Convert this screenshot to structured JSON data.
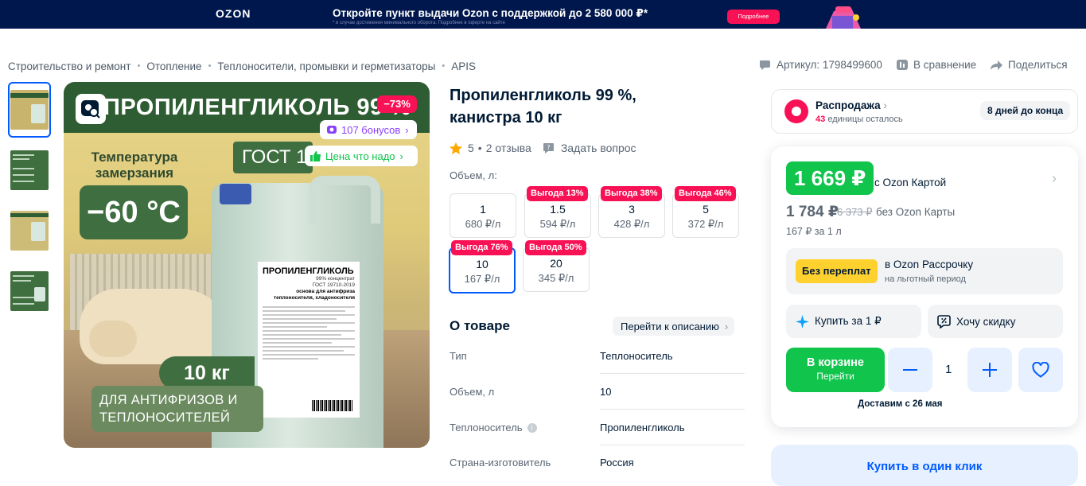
{
  "banner": {
    "logo": "OZON",
    "promo": "Откройте пункт выдачи Ozon с поддержкой до 2 580 000 ₽*",
    "fineprint": "* в случае достижения минимального оборота. Подробнее в оферте на сайте",
    "more_button": "Подробнее"
  },
  "breadcrumb": [
    "Строительство и ремонт",
    "Отопление",
    "Теплоносители, промывки и герметизаторы",
    "APIS"
  ],
  "meta": {
    "article": "Артикул: 1798499600",
    "compare": "В сравнение",
    "share": "Поделиться"
  },
  "gallery": {
    "title": "ПРОПИЛЕНГЛИКОЛЬ 99 %",
    "discount": "−73%",
    "bonus": "107 бонусов",
    "gost": "ГОСТ 1",
    "good_price": "Цена что надо",
    "temp_label": "Температура замерзания",
    "temp_value": "−60 °C",
    "weight": "10 кг",
    "usage": "ДЛЯ АНТИФРИЗОВ И ТЕПЛОНОСИТЕЛЕЙ",
    "label_title": "ПРОПИЛЕНГЛИКОЛЬ",
    "label_line1": "99% концентрат",
    "label_line2": "ГОСТ 19710-2019",
    "label_line3": "основа для антифриза",
    "label_line4": "теплоносителя, хладоносителя"
  },
  "product": {
    "title": "Пропиленгликоль 99 %, канистра 10 кг",
    "rating": "5",
    "reviews": "2 отзыва",
    "ask": "Задать вопрос",
    "volume_label": "Объем, л:"
  },
  "variants": [
    {
      "volume": "1",
      "price_per_l": "680 ₽/л",
      "badge": ""
    },
    {
      "volume": "1.5",
      "price_per_l": "594 ₽/л",
      "badge": "Выгода 13%"
    },
    {
      "volume": "3",
      "price_per_l": "428 ₽/л",
      "badge": "Выгода 38%"
    },
    {
      "volume": "5",
      "price_per_l": "372 ₽/л",
      "badge": "Выгода 46%"
    },
    {
      "volume": "10",
      "price_per_l": "167 ₽/л",
      "badge": "Выгода 76%"
    },
    {
      "volume": "20",
      "price_per_l": "345 ₽/л",
      "badge": "Выгода 50%"
    }
  ],
  "about": {
    "title": "О товаре",
    "to_description": "Перейти к описанию",
    "specs": [
      {
        "name": "Тип",
        "value": "Теплоноситель"
      },
      {
        "name": "Объем, л",
        "value": "10"
      },
      {
        "name": "Теплоноситель",
        "value": "Пропиленгликоль"
      },
      {
        "name": "Страна-изготовитель",
        "value": "Россия"
      }
    ]
  },
  "sale": {
    "title": "Распродажа",
    "count": "43",
    "left": "единицы осталось",
    "days": "8 дней до конца"
  },
  "buy": {
    "price_card": "1 669 ₽",
    "with_card": "с Ozon Картой",
    "price": "1 784 ₽",
    "price_old": "6 373 ₽",
    "without_card": "без Ozon Карты",
    "per_l": "167 ₽ за 1 л",
    "installment_chip": "Без переплат",
    "installment_title": "в Ozon Рассрочку",
    "installment_sub": "на льготный период",
    "buy_for_1": "Купить за 1 ₽",
    "want_discount": "Хочу скидку",
    "in_cart": "В корзине",
    "go": "Перейти",
    "qty": "1",
    "delivery": "Доставим с 26 мая",
    "one_click": "Купить в один клик"
  },
  "colors": {
    "accent": "#005bff",
    "green": "#10c44c",
    "pink": "#f91155",
    "yellow": "#ffd12e"
  }
}
